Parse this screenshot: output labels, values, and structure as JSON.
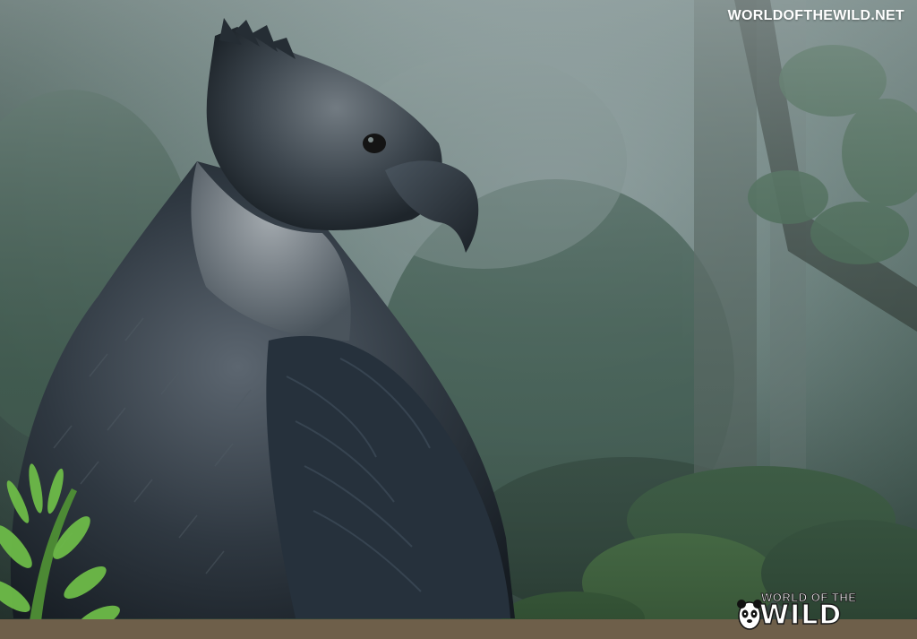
{
  "watermark": {
    "url_text": "WORLDOFTHEWILD.NET"
  },
  "logo": {
    "top_text": "World of the",
    "main_text": "Wild",
    "icon": "panda-icon"
  },
  "colors": {
    "bottom_band": "#6e5f4a",
    "watermark_text": "#ffffff"
  }
}
